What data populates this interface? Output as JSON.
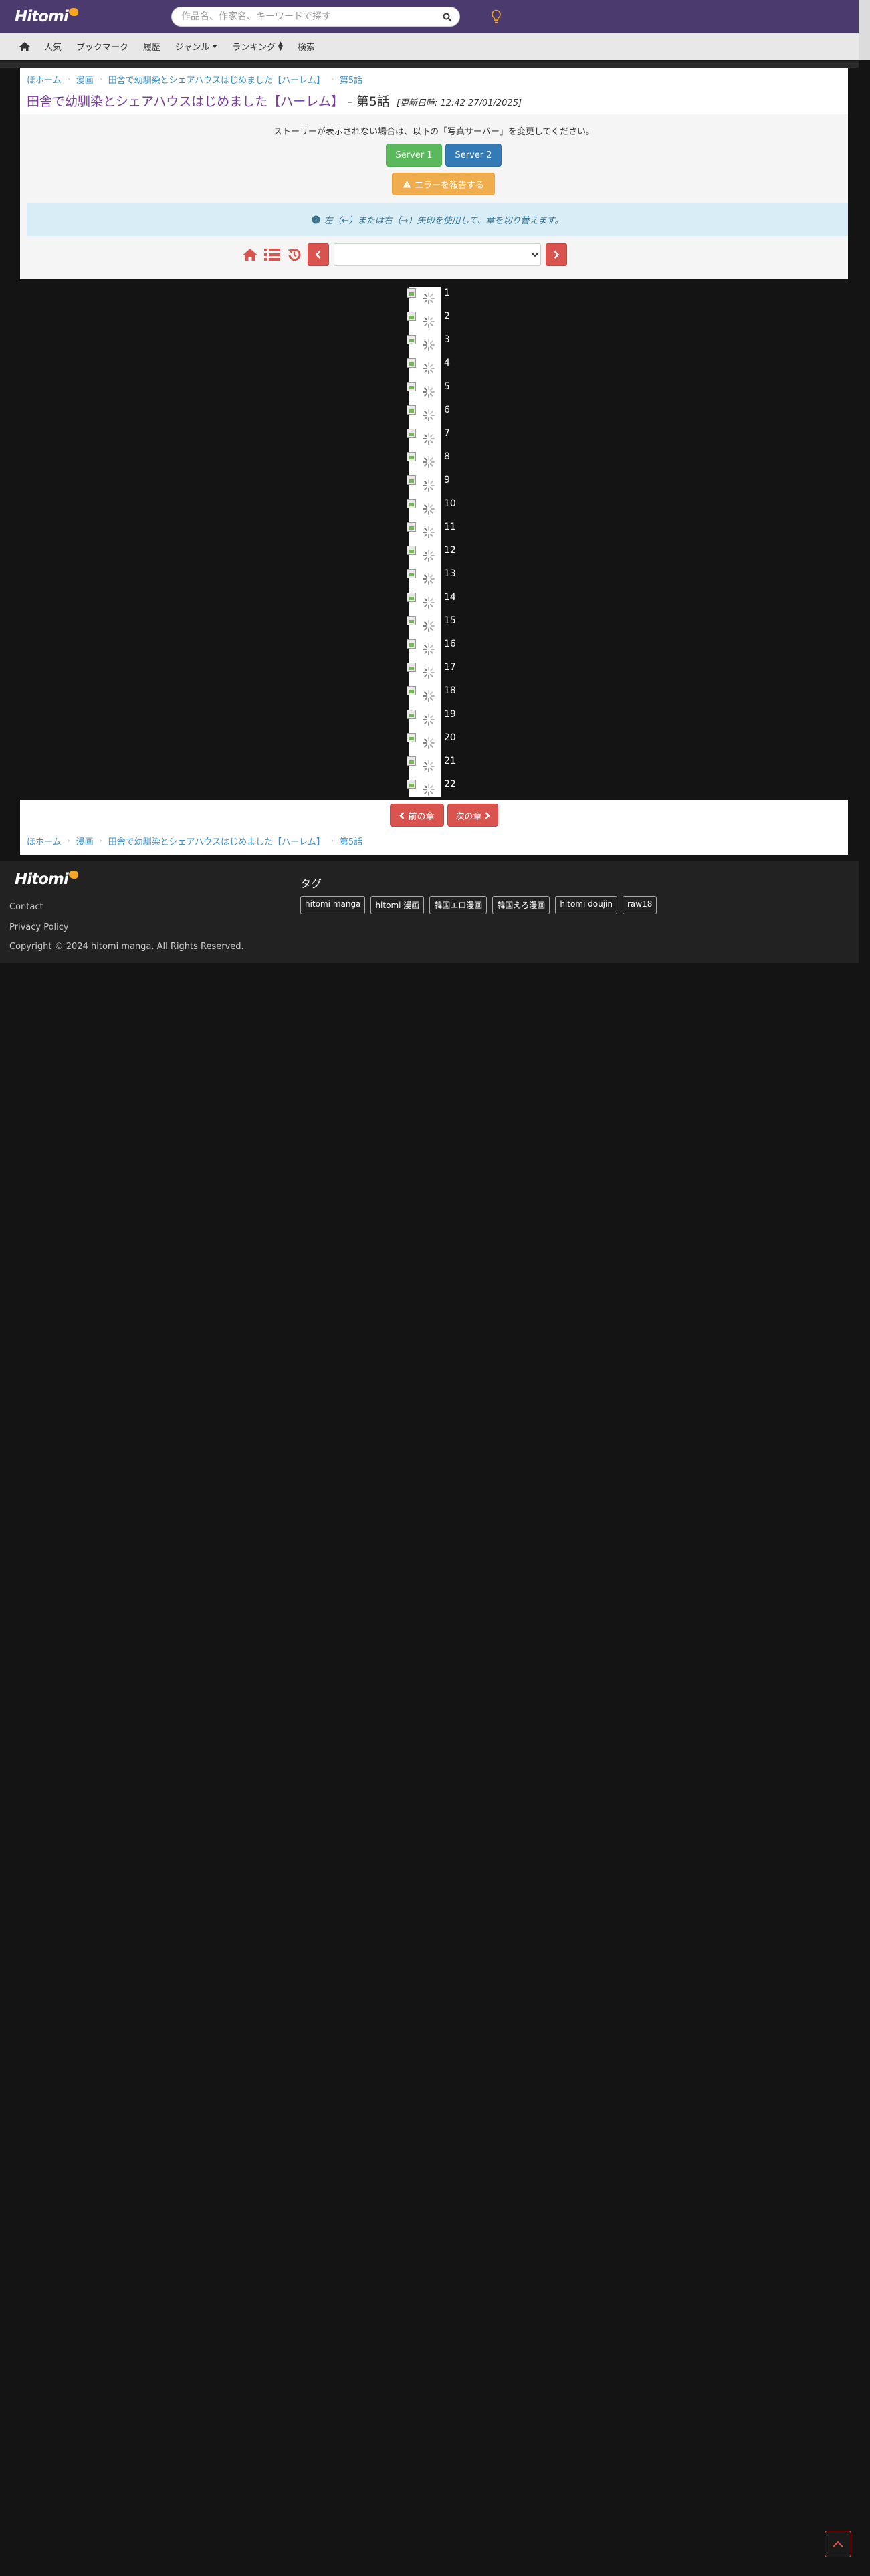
{
  "header": {
    "logo_text": "Hitomi",
    "search_placeholder": "作品名、作家名、キーワードで探す"
  },
  "nav": {
    "items": [
      "人気",
      "ブックマーク",
      "履歴",
      "ジャンル",
      "ランキング",
      "検索"
    ]
  },
  "breadcrumb": {
    "home": "ほホーム",
    "category": "漫画",
    "series": "田舎で幼馴染とシェアハウスはじめました【ハーレム】",
    "chapter": "第5話"
  },
  "title": {
    "series": "田舎で幼馴染とシェアハウスはじめました【ハーレム】",
    "chapter": "- 第5話",
    "updated": "[更新日時: 12:42 27/01/2025]"
  },
  "reader": {
    "server_note": "ストーリーが表示されない場合は、以下の「写真サーバー」を変更してください。",
    "server1": "Server 1",
    "server2": "Server 2",
    "report_error": "エラーを報告する",
    "info_text": "左（←）または右（→）矢印を使用して、章を切り替えます。",
    "chapter_select_value": ""
  },
  "pages": [
    "1",
    "2",
    "3",
    "4",
    "5",
    "6",
    "7",
    "8",
    "9",
    "10",
    "11",
    "12",
    "13",
    "14",
    "15",
    "16",
    "17",
    "18",
    "19",
    "20",
    "21",
    "22"
  ],
  "chapter_nav": {
    "prev": "前の章",
    "next": "次の章"
  },
  "footer": {
    "logo_text": "Hitomi",
    "contact": "Contact",
    "privacy": "Privacy Policy",
    "copyright": "Copyright © 2024 hitomi manga. All Rights Reserved.",
    "tags_title": "タグ",
    "tags": [
      "hitomi manga",
      "hitomi 漫画",
      "韓国エロ漫画",
      "韓国えろ漫画",
      "hitomi doujin",
      "raw18"
    ]
  },
  "colors": {
    "header_bg": "#4a3a6e",
    "accent_red": "#d9534f",
    "accent_orange": "#f5a623",
    "link": "#3a8fc8",
    "title": "#7a3f9a"
  }
}
